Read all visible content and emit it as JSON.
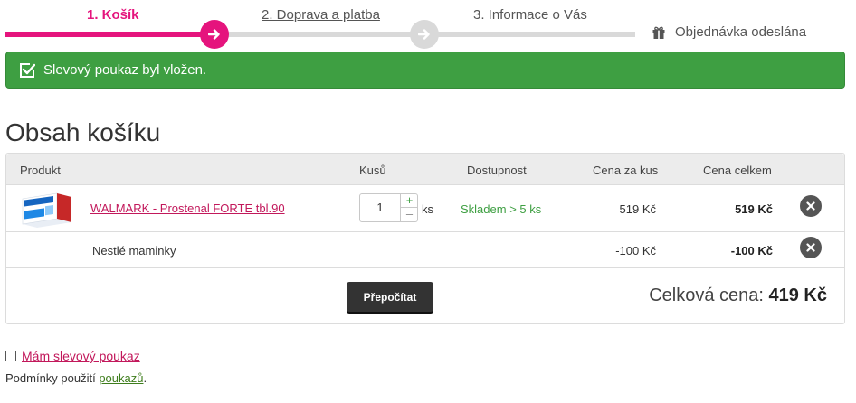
{
  "stepper": {
    "steps": [
      {
        "label": "1. Košík"
      },
      {
        "label": "2. Doprava a platba"
      },
      {
        "label": "3. Informace o Vás"
      },
      {
        "label": "Objednávka odeslána"
      }
    ],
    "active_color": "#e5147d",
    "inactive_color": "#d9d9d9"
  },
  "alert": {
    "text": "Slevový poukaz byl vložen.",
    "color": "#3e9f42"
  },
  "page_title": "Obsah košíku",
  "table": {
    "headers": {
      "product": "Produkt",
      "quantity": "Kusů",
      "availability": "Dostupnost",
      "unit_price": "Cena za kus",
      "total_price": "Cena celkem"
    },
    "items": [
      {
        "name": "WALMARK - Prostenal FORTE tbl.90",
        "quantity": "1",
        "unit": "ks",
        "availability": "Skladem > 5 ks",
        "unit_price": "519 Kč",
        "total_price": "519 Kč"
      }
    ],
    "discount": {
      "name": "Nestlé maminky",
      "unit_price": "-100 Kč",
      "total_price": "-100 Kč"
    },
    "recalculate_label": "Přepočítat",
    "grand_total_label": "Celková cena:",
    "grand_total_value": "419 Kč"
  },
  "voucher": {
    "label": "Mám slevový poukaz"
  },
  "terms": {
    "prefix": "Podmínky použití ",
    "link": "poukazů",
    "suffix": "."
  },
  "colors": {
    "accent": "#e5147d",
    "link": "#c2185b",
    "success": "#3e9f42"
  }
}
